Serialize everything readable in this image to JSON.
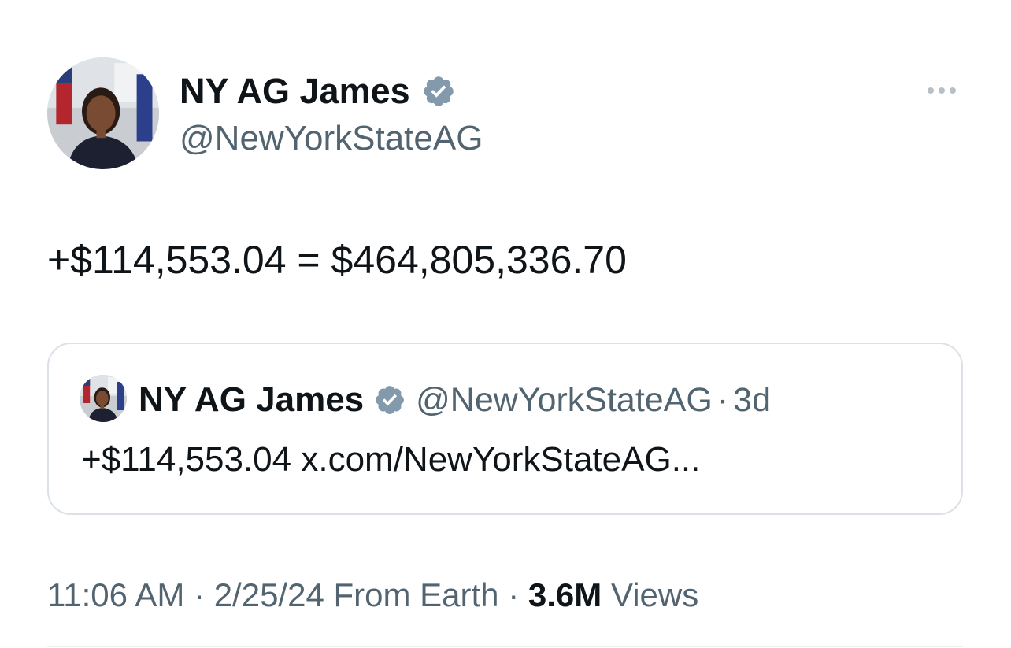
{
  "author": {
    "display_name": "NY AG James",
    "handle": "@NewYorkStateAG",
    "verified_color": "#829aab"
  },
  "tweet": {
    "text": "+$114,553.04 = $464,805,336.70"
  },
  "quote": {
    "display_name": "NY AG James",
    "handle": "@NewYorkStateAG",
    "separator": "·",
    "time_ago": "3d",
    "text": "+$114,553.04",
    "link": "x.com/NewYorkStateAG..."
  },
  "meta": {
    "time": "11:06 AM",
    "sep1": "·",
    "date": "2/25/24",
    "source": "From Earth",
    "sep2": "·",
    "views_count": "3.6M",
    "views_label": "Views"
  },
  "icons": {
    "more": "more-horizontal-icon",
    "verified": "verified-badge-icon"
  }
}
